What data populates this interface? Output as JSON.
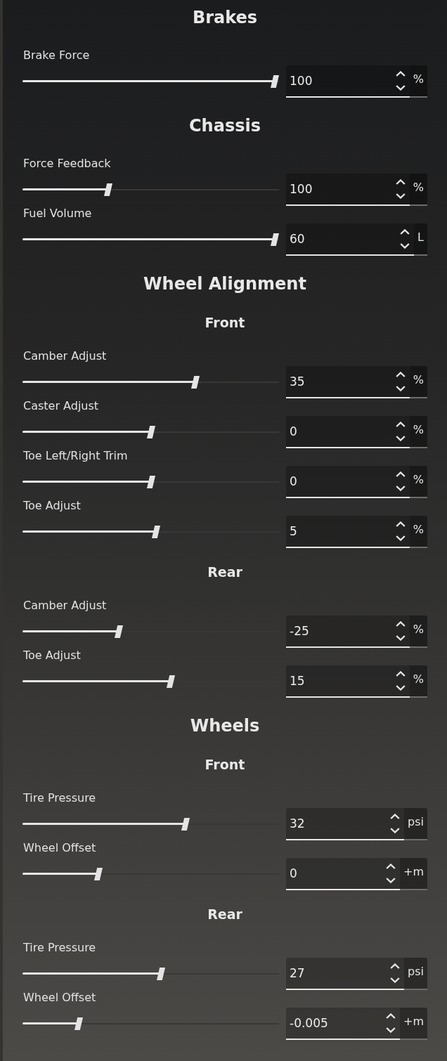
{
  "sections": [
    {
      "title": "Brakes",
      "rows": [
        {
          "label": "Brake Force",
          "level": 1.0,
          "value": "100",
          "unit": "%"
        }
      ]
    },
    {
      "title": "Chassis",
      "rows": [
        {
          "label": "Force Feedback",
          "level": 0.33,
          "value": "100",
          "unit": "%"
        },
        {
          "label": "Fuel Volume",
          "level": 1.0,
          "value": "60",
          "unit": "L"
        }
      ]
    },
    {
      "title": "Wheel Alignment",
      "subsections": [
        {
          "title": "Front",
          "rows": [
            {
              "label": "Camber Adjust",
              "level": 0.68,
              "value": "35",
              "unit": "%"
            },
            {
              "label": "Caster Adjust",
              "level": 0.5,
              "value": "0",
              "unit": "%"
            },
            {
              "label": "Toe Left/Right Trim",
              "level": 0.5,
              "value": "0",
              "unit": "%"
            },
            {
              "label": "Toe Adjust",
              "level": 0.52,
              "value": "5",
              "unit": "%"
            }
          ]
        },
        {
          "title": "Rear",
          "rows": [
            {
              "label": "Camber Adjust",
              "level": 0.37,
              "value": "-25",
              "unit": "%"
            },
            {
              "label": "Toe Adjust",
              "level": 0.58,
              "value": "15",
              "unit": "%"
            }
          ]
        }
      ]
    },
    {
      "title": "Wheels",
      "subsections": [
        {
          "title": "Front",
          "rows": [
            {
              "label": "Tire Pressure",
              "level": 0.64,
              "value": "32",
              "unit": "psi"
            },
            {
              "label": "Wheel Offset",
              "level": 0.29,
              "value": "0",
              "unit": "+m"
            }
          ]
        },
        {
          "title": "Rear",
          "rows": [
            {
              "label": "Tire Pressure",
              "level": 0.54,
              "value": "27",
              "unit": "psi"
            },
            {
              "label": "Wheel Offset",
              "level": 0.21,
              "value": "-0.005",
              "unit": "+m"
            }
          ]
        }
      ]
    }
  ]
}
